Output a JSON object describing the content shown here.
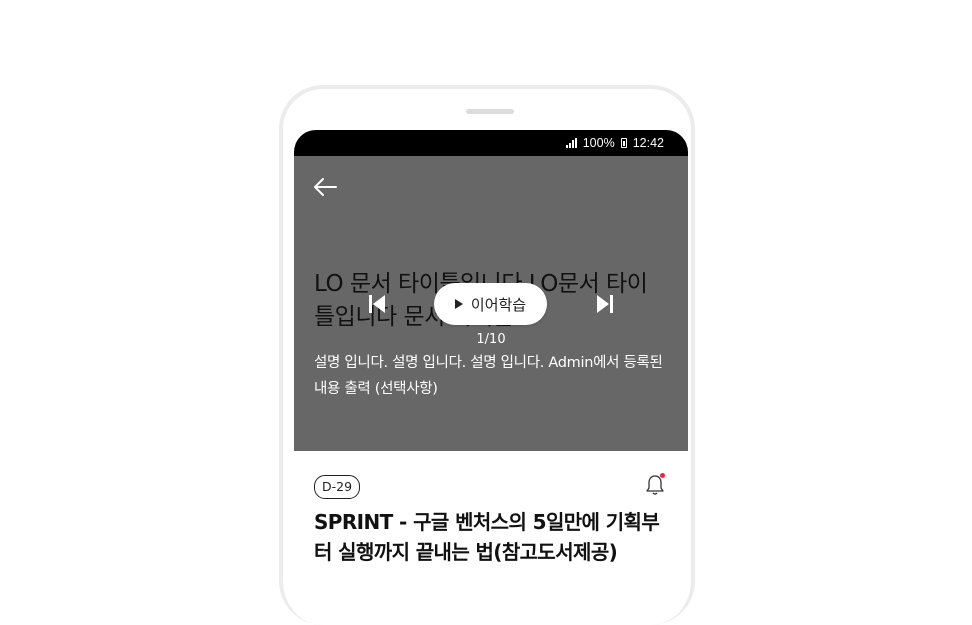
{
  "status_bar": {
    "battery": "100%",
    "time": "12:42"
  },
  "hero": {
    "title": "LO 문서 타이틀입니다 LO문서 타이틀입니다 문서 타이틀",
    "description": "설명 입니다. 설명 입니다. 설명 입니다. Admin에서 등록된 내용 출력 (선택사항)",
    "resume_label": "이어학습",
    "page_counter": "1/10"
  },
  "course": {
    "dday": "D-29",
    "title": "SPRINT - 구글 벤처스의 5일만에 기획부터 실행까지 끝내는 법(참고도서제공)"
  },
  "icons": {
    "back": "arrow-left-icon",
    "prev": "skip-previous-icon",
    "next": "skip-next-icon",
    "play": "play-icon",
    "bell": "bell-icon",
    "signal": "signal-icon",
    "battery": "battery-icon"
  },
  "colors": {
    "hero_background": "#676767",
    "notification_dot": "#e8263c",
    "status_bar": "#000000"
  }
}
